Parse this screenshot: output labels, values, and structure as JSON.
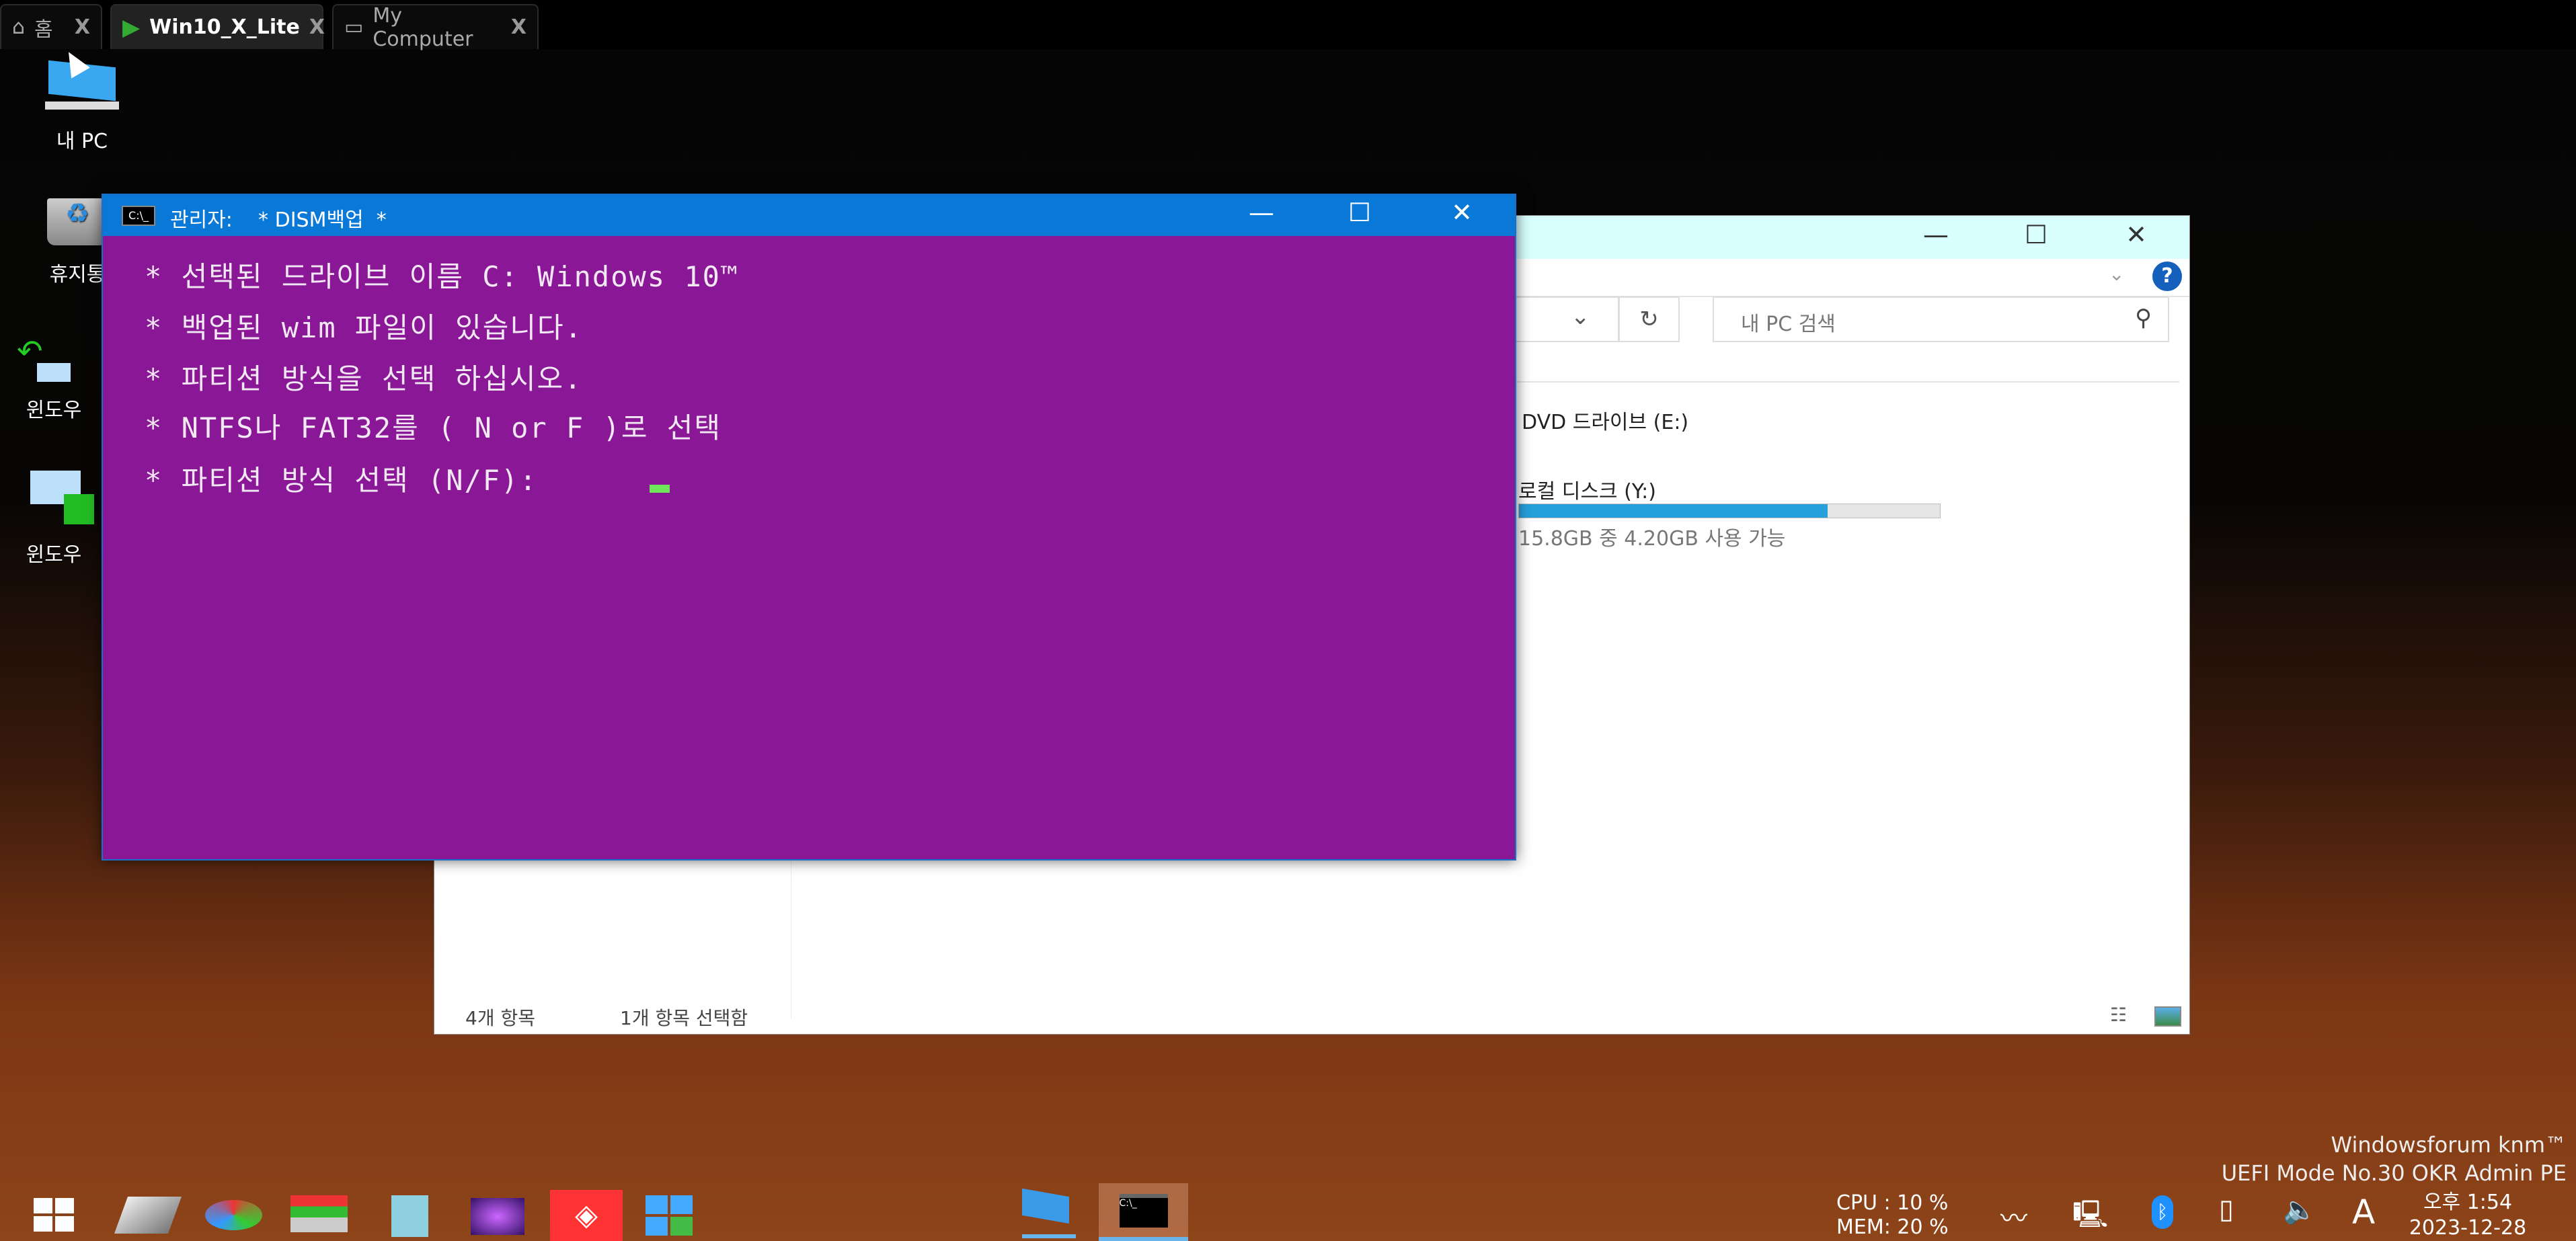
{
  "tabs": [
    {
      "label": "홈",
      "icon": "home-icon",
      "close": "X"
    },
    {
      "label": "Win10_X_Lite",
      "icon": "vm-play-icon",
      "close": "X",
      "active": true
    },
    {
      "label": "My Computer",
      "icon": "monitor-icon",
      "close": "X"
    }
  ],
  "desktop_icons": [
    {
      "label": "내 PC",
      "icon": "computer-icon"
    },
    {
      "label": "휴지통",
      "icon": "recycle-bin-icon"
    },
    {
      "label": "윈도우",
      "icon": "windows-restore-icon"
    },
    {
      "label": "윈도우",
      "icon": "windows-backup-icon"
    }
  ],
  "cmd": {
    "title": "관리자:    * DISM백업  *",
    "bg": "#8a1896",
    "lines": [
      "* 선택된 드라이브 이름 C: Windows 10™",
      "* 백업된 wim 파일이 있습니다.",
      "* 파티션 방식을 선택 하십시오.",
      "* NTFS나 FAT32를 ( N or F )로 선택",
      "* 파티션 방식 선택 (N/F):"
    ],
    "cursor_color": "#6fe65a"
  },
  "explorer": {
    "search_placeholder": "내 PC 검색",
    "drives": [
      {
        "label": "DVD 드라이브 (E:)"
      },
      {
        "label": "로컬 디스크 (Y:)",
        "usage_text": "15.8GB 중 4.20GB 사용 가능",
        "used_fraction": 0.734
      }
    ],
    "status": {
      "count": "4개 항목",
      "selected": "1개 항목 선택함"
    },
    "accent": "#26a0da"
  },
  "watermark": {
    "line1": "Windowsforum knm™",
    "line2": "UEFI Mode No.30 OKR Admin PE"
  },
  "taskbar": {
    "cpu": "CPU : 10 %",
    "mem": "MEM: 20 %",
    "time": "오후 1:54",
    "date": "2023-12-28",
    "ime": "A"
  }
}
